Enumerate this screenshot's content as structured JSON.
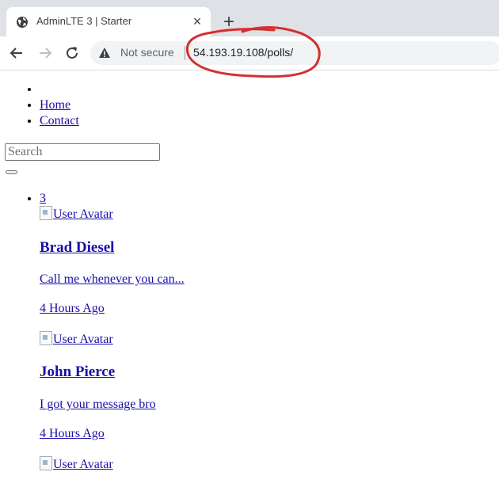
{
  "browser": {
    "tab_title": "AdminLTE 3 | Starter",
    "tab_close": "×",
    "new_tab": "+",
    "security_label": "Not secure",
    "url": "54.193.19.108/polls/"
  },
  "colors": {
    "link": "#1a0dab",
    "annotation": "#d32f2f"
  },
  "nav": {
    "items": [
      {
        "label": ""
      },
      {
        "label": "Home"
      },
      {
        "label": "Contact"
      }
    ]
  },
  "search": {
    "placeholder": "Search"
  },
  "messages": {
    "count": "3",
    "items": [
      {
        "avatar_alt": "User Avatar",
        "name": "Brad Diesel",
        "text": "Call me whenever you can...",
        "time": "4 Hours Ago"
      },
      {
        "avatar_alt": "User Avatar",
        "name": "John Pierce",
        "text": "I got your message bro",
        "time": "4 Hours Ago"
      },
      {
        "avatar_alt": "User Avatar"
      }
    ]
  }
}
